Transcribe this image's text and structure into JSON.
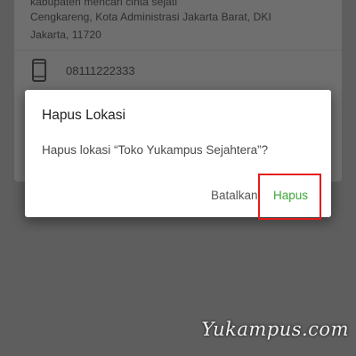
{
  "background_card": {
    "address_lines": [
      "kabupaten mencari cinta sejati",
      "Cengkareng, Kota Administrasi Jakarta Barat, DKI",
      "Jakarta, 11720"
    ],
    "phone_icon": "phone-icon",
    "phone_number": "08111222333"
  },
  "dialog": {
    "title": "Hapus Lokasi",
    "message": "Hapus lokasi “Toko Yukampus Sejahtera”?",
    "cancel_label": "Batalkan",
    "confirm_label": "Hapus"
  },
  "colors": {
    "confirm": "#3fa83a",
    "highlight": "#e31b1b",
    "overlay": "#5e5e5e"
  },
  "watermark": "Yukampus.com"
}
